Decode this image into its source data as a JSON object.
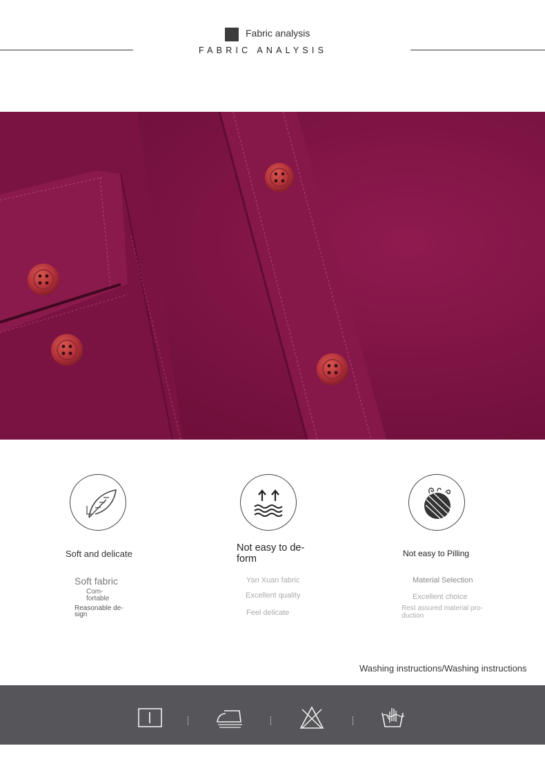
{
  "header": {
    "title": "Fabric analysis",
    "subtitle": "FABRIC ANALYSIS"
  },
  "features": [
    {
      "icon": "feather-icon",
      "title": "Soft and delicate",
      "lines": [
        "Soft fabric",
        "Com-",
        "fortable",
        "Reasonable de-",
        "sign"
      ]
    },
    {
      "icon": "up-arrows-waves-icon",
      "title_line1": "Not easy to de-",
      "title_line2": "form",
      "lines": [
        "Yan Xuan fabric",
        "Excellent quality",
        "Feel delicate"
      ]
    },
    {
      "icon": "yarn-ball-icon",
      "title": "Not easy to Pilling",
      "lines": [
        "Material Selection",
        "Excellent choice",
        "Rest assured material pro-",
        "duction"
      ]
    }
  ],
  "washing": {
    "label": "Washing instructions/Washing instructions",
    "icons": [
      "tumble-dry-icon",
      "iron-icon",
      "no-bleach-icon",
      "hand-wash-icon"
    ]
  },
  "colors": {
    "fabric": "#7e1443",
    "button": "#b9333b",
    "wash_bar": "#55555a"
  }
}
